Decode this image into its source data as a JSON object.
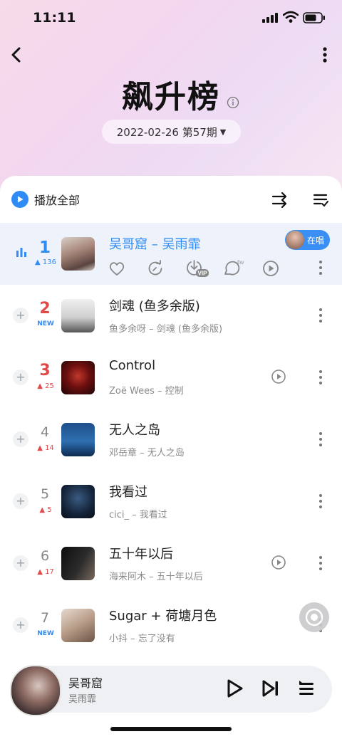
{
  "status_bar": {
    "time": "11:11"
  },
  "header": {
    "title": "飙升榜",
    "date_period": "2022-02-26 第57期"
  },
  "toolbar": {
    "play_all_label": "播放全部"
  },
  "now_playing_row": {
    "rank": "1",
    "delta": "136",
    "title": "吴哥窟 – 吴雨霏",
    "singing_badge": "在唱",
    "comment_count": "4w",
    "vip_label": "VIP"
  },
  "songs": [
    {
      "rank": "2",
      "delta": "NEW",
      "title": "剑魂 (鱼多余版)",
      "subtitle": "鱼多余呀 – 剑魂 (鱼多余版)"
    },
    {
      "rank": "3",
      "delta": "25",
      "title": "Control",
      "subtitle": "Zoë Wees – 控制"
    },
    {
      "rank": "4",
      "delta": "14",
      "title": "无人之岛",
      "subtitle": "邓岳章 – 无人之岛"
    },
    {
      "rank": "5",
      "delta": "5",
      "title": "我看过",
      "subtitle": "cici_ – 我看过"
    },
    {
      "rank": "6",
      "delta": "17",
      "title": "五十年以后",
      "subtitle": "海来阿木 – 五十年以后"
    },
    {
      "rank": "7",
      "delta": "NEW",
      "title": "Sugar + 荷塘月色",
      "subtitle": "小抖 – 忘了没有"
    }
  ],
  "mini_player": {
    "song": "吴哥窟",
    "artist": "吴雨霏"
  },
  "colors": {
    "accent": "#2f8cf7",
    "up": "#e24a4a"
  }
}
